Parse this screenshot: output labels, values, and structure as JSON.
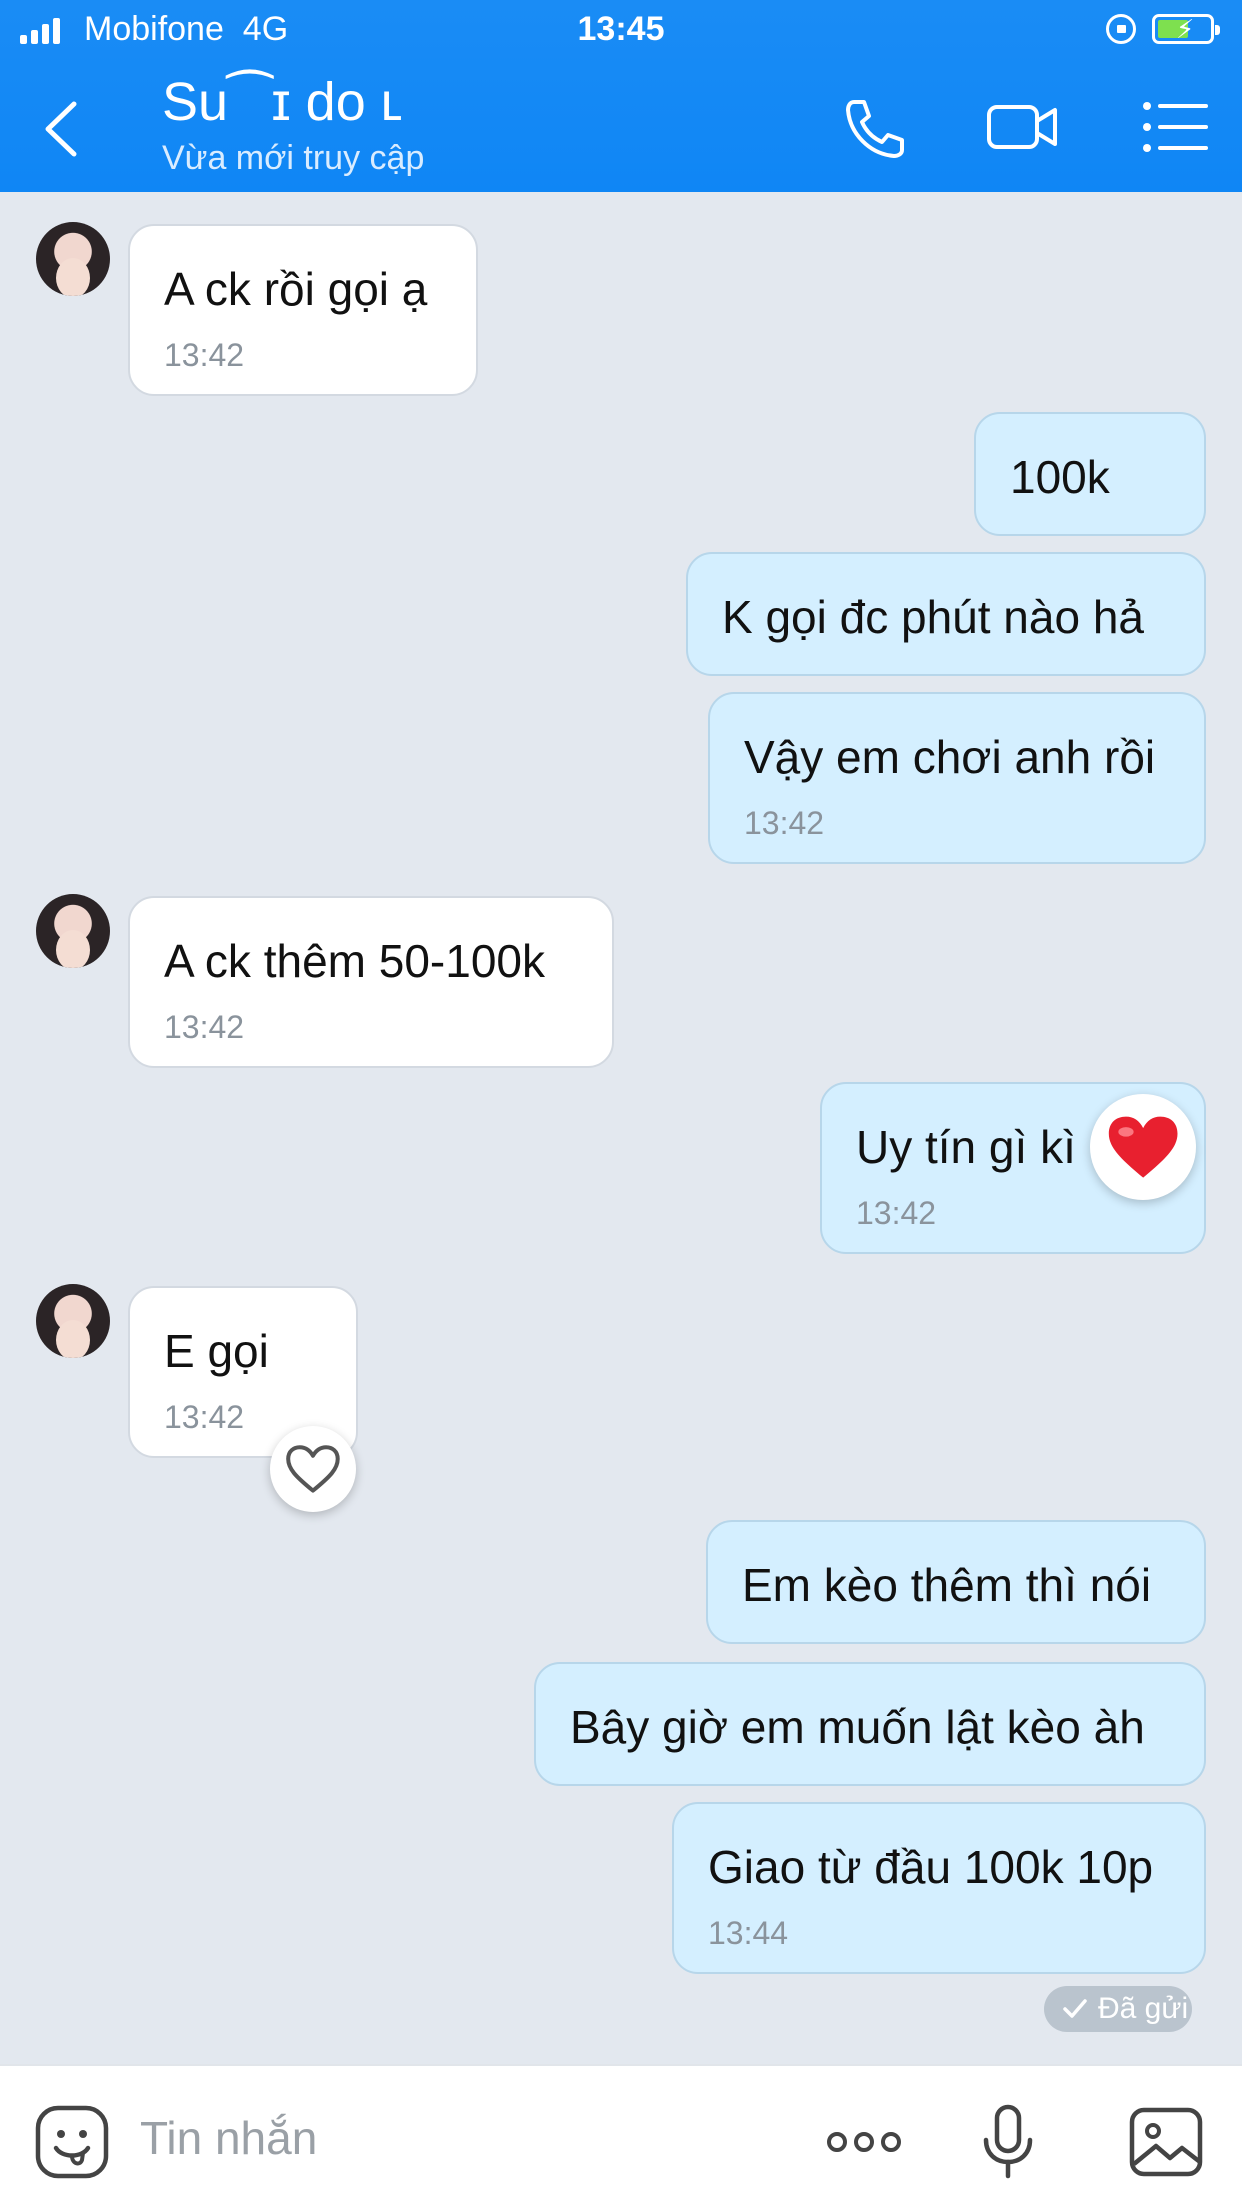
{
  "status_bar": {
    "carrier": "Mobifone",
    "network": "4G",
    "time": "13:45"
  },
  "header": {
    "contact_name": "Su⁀ɪ do ʟ",
    "presence": "Vừa mới truy cập"
  },
  "messages": [
    {
      "from": "them",
      "text": "A ck rồi gọi ạ",
      "time": "13:42"
    },
    {
      "from": "me",
      "text": "100k"
    },
    {
      "from": "me",
      "text": "K gọi đc phút nào hả"
    },
    {
      "from": "me",
      "text": "Vậy em chơi anh rồi",
      "time": "13:42"
    },
    {
      "from": "them",
      "text": "A ck thêm 50-100k",
      "time": "13:42"
    },
    {
      "from": "me",
      "text": "Uy tín gì kì",
      "time": "13:42",
      "reaction": "heart"
    },
    {
      "from": "them",
      "text": "E gọi",
      "time": "13:42",
      "reaction": "heart-outline"
    },
    {
      "from": "me",
      "text": "Em kèo thêm thì nói"
    },
    {
      "from": "me",
      "text": "Bây giờ em muốn lật kèo àh"
    },
    {
      "from": "me",
      "text": "Giao từ đầu 100k 10p",
      "time": "13:44"
    }
  ],
  "delivery_status": "Đã gửi",
  "input": {
    "placeholder": "Tin nhắn",
    "value": ""
  },
  "icons": [
    "back-icon",
    "phone-icon",
    "video-call-icon",
    "menu-icon",
    "sticker-icon",
    "more-icon",
    "microphone-icon",
    "image-icon"
  ],
  "colors": {
    "header": "#0f86f5",
    "chat_background": "#e3e8ef",
    "outgoing_bubble": "#d4efff",
    "incoming_bubble": "#ffffff",
    "reaction_heart": "#e8202f"
  }
}
